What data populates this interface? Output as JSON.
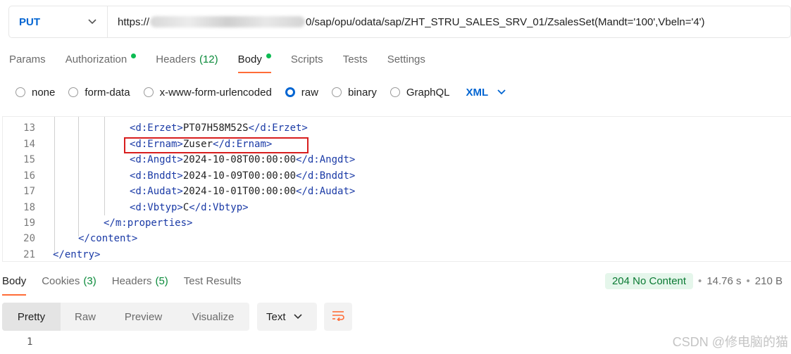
{
  "request": {
    "method": "PUT",
    "url_prefix": "https://",
    "url_suffix": "0/sap/opu/odata/sap/ZHT_STRU_SALES_SRV_01/ZsalesSet(Mandt='100',Vbeln='4')"
  },
  "request_tabs": [
    {
      "label": "Params"
    },
    {
      "label": "Authorization"
    },
    {
      "label": "Headers",
      "count": "(12)"
    },
    {
      "label": "Body"
    },
    {
      "label": "Scripts"
    },
    {
      "label": "Tests"
    },
    {
      "label": "Settings"
    }
  ],
  "body_types": [
    "none",
    "form-data",
    "x-www-form-urlencoded",
    "raw",
    "binary",
    "GraphQL"
  ],
  "body_selected": "raw",
  "body_format": "XML",
  "editor": {
    "lines": [
      {
        "num": "13",
        "open": "<d:Erzet>",
        "text": "PT07H58M52S",
        "close": "</d:Erzet>"
      },
      {
        "num": "14",
        "open": "<d:Ernam>",
        "text": "Zuser",
        "close": "</d:Ernam>"
      },
      {
        "num": "15",
        "open": "<d:Angdt>",
        "text": "2024-10-08T00:00:00",
        "close": "</d:Angdt>"
      },
      {
        "num": "16",
        "open": "<d:Bnddt>",
        "text": "2024-10-09T00:00:00",
        "close": "</d:Bnddt>"
      },
      {
        "num": "17",
        "open": "<d:Audat>",
        "text": "2024-10-01T00:00:00",
        "close": "</d:Audat>"
      },
      {
        "num": "18",
        "open": "<d:Vbtyp>",
        "text": "C",
        "close": "</d:Vbtyp>"
      },
      {
        "num": "19",
        "open": "</m:properties>",
        "text": "",
        "close": ""
      },
      {
        "num": "20",
        "open": "</content>",
        "text": "",
        "close": ""
      },
      {
        "num": "21",
        "open": "</entry>",
        "text": "",
        "close": ""
      }
    ]
  },
  "response_tabs": [
    {
      "label": "Body"
    },
    {
      "label": "Cookies",
      "count": "(3)"
    },
    {
      "label": "Headers",
      "count": "(5)"
    },
    {
      "label": "Test Results"
    }
  ],
  "response_status": {
    "status": "204 No Content",
    "time": "14.76 s",
    "size": "210 B"
  },
  "view_modes": [
    "Pretty",
    "Raw",
    "Preview",
    "Visualize"
  ],
  "response_format": "Text",
  "response_body": {
    "line_number": "1"
  },
  "watermark": "CSDN @修电脑的猫",
  "colors": {
    "accent": "#ff6c37",
    "method": "#0265d2",
    "xml_tag": "#1a3aa6",
    "status_ok": "#0a7a33",
    "highlight_box": "#d81e1e"
  }
}
